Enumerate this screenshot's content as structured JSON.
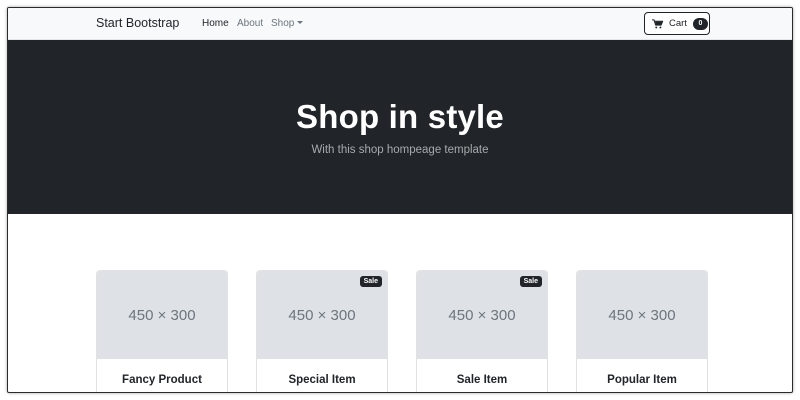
{
  "navbar": {
    "brand": "Start Bootstrap",
    "links": [
      {
        "label": "Home",
        "active": true
      },
      {
        "label": "About",
        "active": false
      },
      {
        "label": "Shop",
        "active": false
      }
    ],
    "cart": {
      "label": "Cart",
      "count": "0",
      "icon": "cart-icon"
    }
  },
  "hero": {
    "title": "Shop in style",
    "subtitle": "With this shop hompeage template"
  },
  "products": [
    {
      "image_text": "450 × 300",
      "name": "Fancy Product",
      "badge": ""
    },
    {
      "image_text": "450 × 300",
      "name": "Special Item",
      "badge": "Sale"
    },
    {
      "image_text": "450 × 300",
      "name": "Sale Item",
      "badge": "Sale"
    },
    {
      "image_text": "450 × 300",
      "name": "Popular Item",
      "badge": ""
    }
  ],
  "colors": {
    "dark": "#212529",
    "muted": "#6c757d",
    "placeholder": "#dee2e6",
    "navbar_bg": "#f8f9fa"
  }
}
